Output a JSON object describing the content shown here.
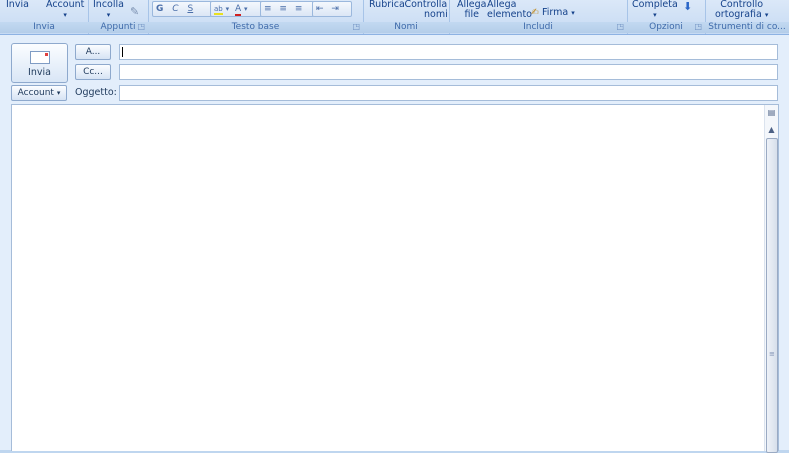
{
  "ribbon": {
    "groups": {
      "send": {
        "label": "Invia",
        "buttons": [
          "Invia",
          "Account"
        ]
      },
      "clipboard": {
        "label": "Appunti",
        "paste": "Incolla"
      },
      "basic_text": {
        "label": "Testo base",
        "bold": "G",
        "italic": "C",
        "underline": "S",
        "highlight": "ab",
        "font_color": "A"
      },
      "names": {
        "label": "Nomi",
        "address_book": "Rubrica",
        "check_names_1": "Controlla",
        "check_names_2": "nomi"
      },
      "include": {
        "label": "Includi",
        "attach_file_1": "Allega",
        "attach_file_2": "file",
        "attach_item_1": "Allega",
        "attach_item_2": "elemento",
        "signature": "Firma"
      },
      "options": {
        "label": "Opzioni",
        "follow_up": "Completa"
      },
      "proofing": {
        "label": "Strumenti di co...",
        "spelling_1": "Controllo",
        "spelling_2": "ortografia"
      }
    }
  },
  "compose": {
    "send_button": "Invia",
    "to_button": "A...",
    "cc_button": "Cc...",
    "account_button": "Account",
    "subject_label": "Oggetto:",
    "to_value": "",
    "cc_value": "",
    "subject_value": "",
    "body_value": ""
  }
}
